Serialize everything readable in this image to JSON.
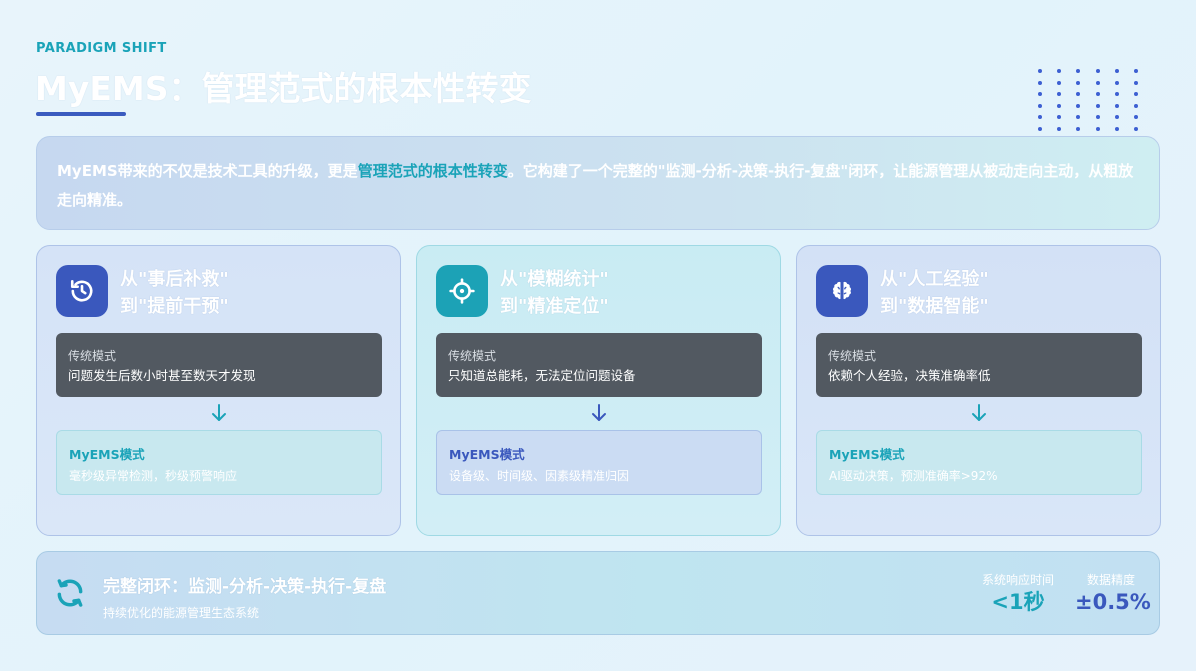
{
  "header": {
    "kicker": "PARADIGM SHIFT",
    "title": "MyEMS：管理范式的根本性转变"
  },
  "intro": {
    "before": "MyEMS带来的不仅是技术工具的升级，更是",
    "highlight": "管理范式的根本性转变",
    "after": "。它构建了一个完整的\"监测-分析-决策-执行-复盘\"闭环，让能源管理从被动走向主动，从粗放走向精准。"
  },
  "cards": [
    {
      "icon": "history-icon",
      "line1": "从\"事后补救\"",
      "line2": "到\"提前干预\"",
      "trad_label": "传统模式",
      "trad_text": "问题发生后数小时甚至数天才发现",
      "mye_label": "MyEMS模式",
      "mye_text": "毫秒级异常检测，秒级预警响应"
    },
    {
      "icon": "crosshair-icon",
      "line1": "从\"模糊统计\"",
      "line2": "到\"精准定位\"",
      "trad_label": "传统模式",
      "trad_text": "只知道总能耗，无法定位问题设备",
      "mye_label": "MyEMS模式",
      "mye_text": "设备级、时间级、因素级精准归因"
    },
    {
      "icon": "brain-icon",
      "line1": "从\"人工经验\"",
      "line2": "到\"数据智能\"",
      "trad_label": "传统模式",
      "trad_text": "依赖个人经验，决策准确率低",
      "mye_label": "MyEMS模式",
      "mye_text": "AI驱动决策，预测准确率>92%"
    }
  ],
  "bottom": {
    "title": "完整闭环：监测-分析-决策-执行-复盘",
    "subtitle": "持续优化的能源管理生态系统",
    "metrics": [
      {
        "label": "系统响应时间",
        "value": "<1秒"
      },
      {
        "label": "数据精度",
        "value": "±0.5%"
      }
    ]
  },
  "colors": {
    "accent_teal": "#1aa3b8",
    "accent_blue": "#3a58bd",
    "dark_panel": "#525961"
  }
}
